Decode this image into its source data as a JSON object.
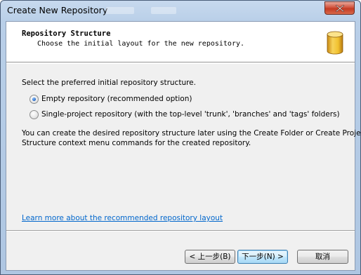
{
  "window": {
    "title": "Create New Repository"
  },
  "header": {
    "title": "Repository Structure",
    "subtitle": "Choose the initial layout for the new repository.",
    "icon": "database-cylinder-icon"
  },
  "main": {
    "prompt": "Select the preferred initial repository structure.",
    "options": [
      {
        "label": "Empty repository (recommended option)",
        "checked": true
      },
      {
        "label": "Single-project repository (with the top-level 'trunk', 'branches' and 'tags' folders)",
        "checked": false
      }
    ],
    "note_line1": "You can create the desired repository structure later using the Create Folder or Create Project",
    "note_line2": "Structure context menu commands for the created repository.",
    "learn_more_link": "Learn more about the recommended repository layout"
  },
  "footer": {
    "back_label": "< 上一步(B)",
    "next_label": "下一步(N) >",
    "cancel_label": "取消"
  },
  "colors": {
    "link": "#0066cc",
    "close_button": "#c43a22",
    "db_icon": "#f2c230"
  }
}
